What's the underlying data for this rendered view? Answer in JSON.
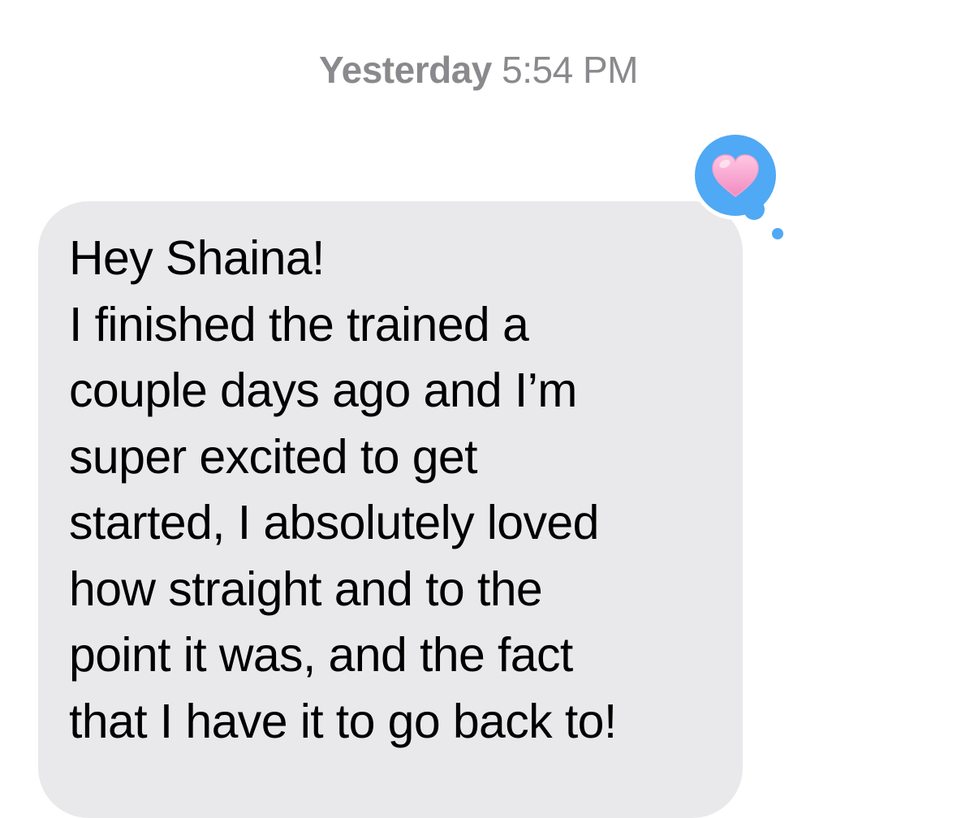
{
  "thread": {
    "timestamp_day": "Yesterday",
    "timestamp_time": "5:54 PM"
  },
  "message": {
    "sender": "incoming",
    "lines": [
      "Hey Shaina!",
      "I finished the trained a",
      "couple days ago and I’m",
      "super excited to get",
      "started, I absolutely loved",
      "how straight and to the",
      "point it was, and the fact",
      "that I have it to go back to!"
    ],
    "tapback": {
      "icon": "heart-icon",
      "bubble_color": "#4fa9f5",
      "heart_color": "#f7a1cc"
    }
  },
  "colors": {
    "incoming_bubble": "#e9e9eb",
    "timestamp_text": "#8a8a8e"
  }
}
